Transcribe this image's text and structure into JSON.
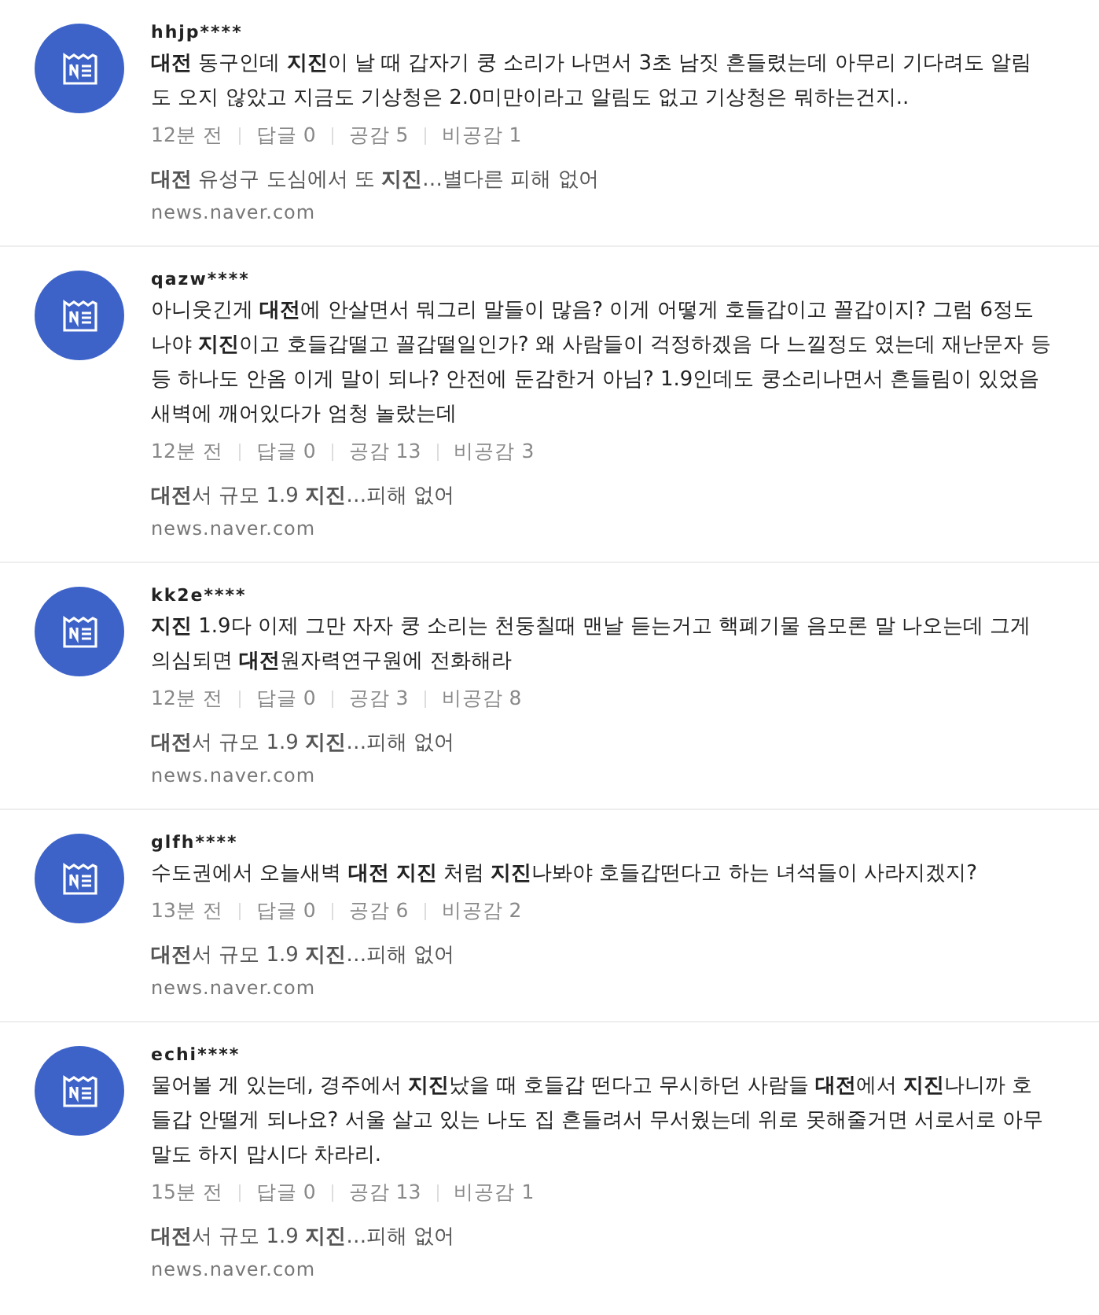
{
  "comments": [
    {
      "user": "hhjp****",
      "body": "**대전** 동구인데 **지진**이 날 때 갑자기 쿵 소리가 나면서 3초 남짓 흔들렸는데 아무리 기다려도 알림도 오지 않았고 지금도 기상청은 2.0미만이라고 알림도 없고 기상청은 뭐하는건지..",
      "time": "12분 전",
      "replies": "답글 0",
      "likes": "공감 5",
      "dislikes": "비공감 1",
      "news_title": "**대전** 유성구 도심에서 또 **지진**…별다른 피해 없어",
      "news_source": "news.naver.com"
    },
    {
      "user": "qazw****",
      "body": "아니웃긴게 **대전**에 안살면서 뭐그리 말들이 많음? 이게 어떻게 호들갑이고 꼴갑이지? 그럼 6정도 나야 **지진**이고 호들갑떨고 꼴갑떨일인가? 왜 사람들이 걱정하겠음 다 느낄정도 였는데 재난문자 등등 하나도 안옴 이게 말이 되나? 안전에 둔감한거 아님? 1.9인데도 쿵소리나면서 흔들림이 있었음 새벽에 깨어있다가 엄청 놀랐는데",
      "time": "12분 전",
      "replies": "답글 0",
      "likes": "공감 13",
      "dislikes": "비공감 3",
      "news_title": "**대전**서 규모 1.9 **지진**…피해 없어",
      "news_source": "news.naver.com"
    },
    {
      "user": "kk2e****",
      "body": "**지진** 1.9다 이제 그만 자자 쿵 소리는 천둥칠때 맨날 듣는거고 핵폐기물 음모론 말 나오는데 그게 의심되면 **대전**원자력연구원에 전화해라",
      "time": "12분 전",
      "replies": "답글 0",
      "likes": "공감 3",
      "dislikes": "비공감 8",
      "news_title": "**대전**서 규모 1.9 **지진**…피해 없어",
      "news_source": "news.naver.com"
    },
    {
      "user": "glfh****",
      "body": "수도권에서 오늘새벽 **대전 지진** 처럼 **지진**나봐야 호들갑떤다고 하는 녀석들이 사라지겠지?",
      "time": "13분 전",
      "replies": "답글 0",
      "likes": "공감 6",
      "dislikes": "비공감 2",
      "news_title": "**대전**서 규모 1.9 **지진**…피해 없어",
      "news_source": "news.naver.com"
    },
    {
      "user": "echi****",
      "body": "물어볼 게 있는데, 경주에서 **지진**났을 때 호들갑 떤다고 무시하던 사람들 **대전**에서 **지진**나니까 호들갑 안떨게 되나요? 서울 살고 있는 나도 집 흔들려서 무서웠는데 위로 못해줄거면 서로서로 아무 말도 하지 맙시다 차라리.",
      "time": "15분 전",
      "replies": "답글 0",
      "likes": "공감 13",
      "dislikes": "비공감 1",
      "news_title": "**대전**서 규모 1.9 **지진**…피해 없어",
      "news_source": "news.naver.com"
    }
  ]
}
